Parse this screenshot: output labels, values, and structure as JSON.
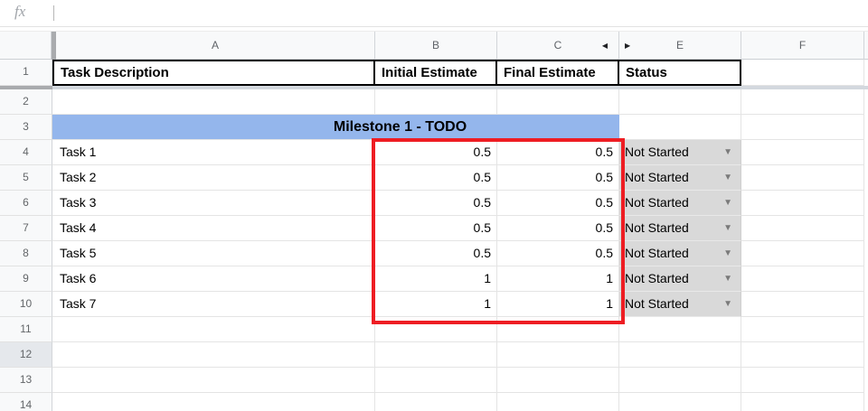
{
  "formula_bar": {
    "fx_label": "fx"
  },
  "icons": {
    "hidden_column_left": "◀",
    "hidden_column_right": "▶",
    "status_dropdown": "▼"
  },
  "columns": {
    "headers": [
      "A",
      "B",
      "C",
      "E",
      "F"
    ]
  },
  "rows": {
    "numbers": [
      "1",
      "2",
      "3",
      "4",
      "5",
      "6",
      "7",
      "8",
      "9",
      "10",
      "11",
      "12",
      "13",
      "14"
    ]
  },
  "header_row": {
    "task_description": "Task Description",
    "initial_estimate": "Initial Estimate",
    "final_estimate": "Final Estimate",
    "status": "Status"
  },
  "milestone": {
    "title": "Milestone 1 - TODO"
  },
  "tasks": [
    {
      "name": "Task 1",
      "initial": "0.5",
      "final": "0.5",
      "status": "Not Started"
    },
    {
      "name": "Task 2",
      "initial": "0.5",
      "final": "0.5",
      "status": "Not Started"
    },
    {
      "name": "Task 3",
      "initial": "0.5",
      "final": "0.5",
      "status": "Not Started"
    },
    {
      "name": "Task 4",
      "initial": "0.5",
      "final": "0.5",
      "status": "Not Started"
    },
    {
      "name": "Task 5",
      "initial": "0.5",
      "final": "0.5",
      "status": "Not Started"
    },
    {
      "name": "Task 6",
      "initial": "1",
      "final": "1",
      "status": "Not Started"
    },
    {
      "name": "Task 7",
      "initial": "1",
      "final": "1",
      "status": "Not Started"
    }
  ],
  "colors": {
    "milestone_bg": "#94b6ec",
    "status_cell_bg": "#d9d9d9",
    "selection_border_red": "#ee1d23",
    "header_strip_bg": "#f8f9fa"
  }
}
